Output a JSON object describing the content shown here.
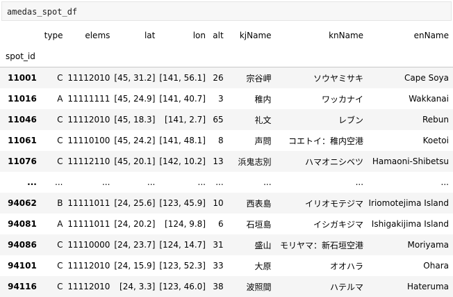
{
  "code_cell": {
    "input": "amedas_spot_df"
  },
  "table": {
    "columns": [
      "type",
      "elems",
      "lat",
      "lon",
      "alt",
      "kjName",
      "knName",
      "enName"
    ],
    "index_name": "spot_id",
    "rows": [
      {
        "id": "11001",
        "cells": [
          "C",
          "11112010",
          "[45, 31.2]",
          "[141, 56.1]",
          "26",
          "宗谷岬",
          "ソウヤミサキ",
          "Cape Soya"
        ]
      },
      {
        "id": "11016",
        "cells": [
          "A",
          "11111111",
          "[45, 24.9]",
          "[141, 40.7]",
          "3",
          "稚内",
          "ワッカナイ",
          "Wakkanai"
        ]
      },
      {
        "id": "11046",
        "cells": [
          "C",
          "11112010",
          "[45, 18.3]",
          "[141, 2.7]",
          "65",
          "礼文",
          "レブン",
          "Rebun"
        ]
      },
      {
        "id": "11061",
        "cells": [
          "C",
          "11110100",
          "[45, 24.2]",
          "[141, 48.1]",
          "8",
          "声問",
          "コエトイ：稚内空港",
          "Koetoi"
        ]
      },
      {
        "id": "11076",
        "cells": [
          "C",
          "11112110",
          "[45, 20.1]",
          "[142, 10.2]",
          "13",
          "浜鬼志別",
          "ハマオニシベツ",
          "Hamaoni-Shibetsu"
        ]
      },
      {
        "id": "...",
        "cells": [
          "...",
          "...",
          "...",
          "...",
          "...",
          "...",
          "...",
          "..."
        ]
      },
      {
        "id": "94062",
        "cells": [
          "B",
          "11111011",
          "[24, 25.6]",
          "[123, 45.9]",
          "10",
          "西表島",
          "イリオモテジマ",
          "Iriomotejima Island"
        ]
      },
      {
        "id": "94081",
        "cells": [
          "A",
          "11111011",
          "[24, 20.2]",
          "[124, 9.8]",
          "6",
          "石垣島",
          "イシガキジマ",
          "Ishigakijima Island"
        ]
      },
      {
        "id": "94086",
        "cells": [
          "C",
          "11110000",
          "[24, 23.7]",
          "[124, 14.7]",
          "31",
          "盛山",
          "モリヤマ：新石垣空港",
          "Moriyama"
        ]
      },
      {
        "id": "94101",
        "cells": [
          "C",
          "11112010",
          "[24, 15.9]",
          "[123, 52.3]",
          "33",
          "大原",
          "オオハラ",
          "Ohara"
        ]
      },
      {
        "id": "94116",
        "cells": [
          "C",
          "11112010",
          "[24, 3.3]",
          "[123, 46.0]",
          "38",
          "波照間",
          "ハテルマ",
          "Hateruma"
        ]
      }
    ]
  }
}
